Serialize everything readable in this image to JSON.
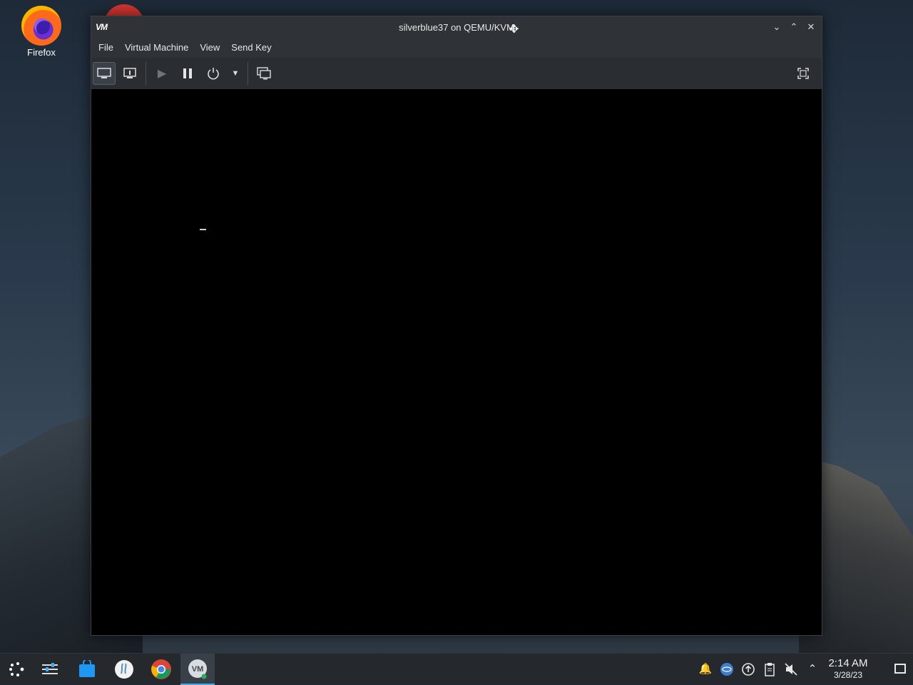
{
  "desktop": {
    "icons": [
      {
        "label": "Firefox",
        "icon": "firefox-icon"
      }
    ]
  },
  "window": {
    "app_logo": "VM",
    "title": "silverblue37 on QEMU/KVM",
    "controls": [
      "minimize-icon",
      "maximize-icon",
      "close-icon"
    ],
    "menu": [
      "File",
      "Virtual Machine",
      "View",
      "Send Key"
    ],
    "toolbar": {
      "buttons": [
        "console-icon",
        "details-icon",
        "run-icon",
        "pause-icon",
        "power-icon",
        "dropdown-arrow-icon",
        "snapshots-icon"
      ],
      "right": "fullscreen-icon"
    }
  },
  "taskbar": {
    "apps": [
      "app-launcher-icon",
      "system-settings-icon",
      "discover-store-icon",
      "flatseal-icon",
      "chrome-icon",
      "virt-manager-icon"
    ],
    "tray": [
      "notifications-icon",
      "network-icon",
      "updates-icon",
      "clipboard-icon",
      "volume-muted-icon",
      "expand-tray-icon"
    ],
    "clock": {
      "time": "2:14 AM",
      "date": "3/28/23"
    }
  },
  "colors": {
    "accent": "#3daee9",
    "vm_screen": "#000000"
  }
}
